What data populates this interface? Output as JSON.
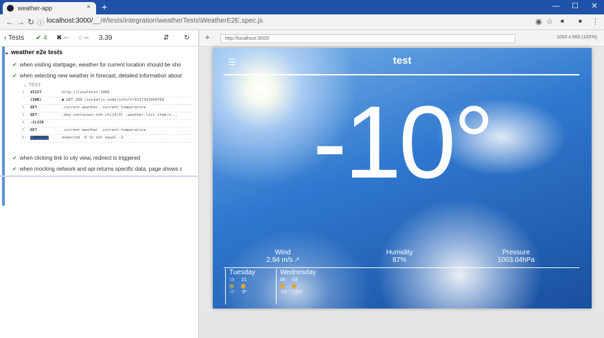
{
  "browser": {
    "tab_title": "weather-app",
    "tab_close": "×",
    "new_tab": "+",
    "url_host": "localhost:3000/",
    "url_path": "__/#/tests/integration\\weatherTests\\WeatherE2E.spec.js",
    "win_min": "—",
    "win_max": "☐",
    "win_close": "✕"
  },
  "runner": {
    "back_label": "Tests",
    "passed": "4",
    "failed": "--",
    "pending": "--",
    "duration": "3.39",
    "suite": "weather e2e tests",
    "tests": [
      "when visiting startpage, weather for current location should be sho",
      "when selecting new weather in forecast, detailed information about",
      "when clicking link to city view, redirect is triggered",
      "when mocking network and api returns specific data, page shows c"
    ],
    "test_label": "TEST",
    "commands": [
      {
        "n": "1",
        "name": "VISIT",
        "msg": "http://localhost:3000"
      },
      {
        "n": "",
        "name": "(XHR)",
        "msg": "● GET 200 /socketjs-node/info?t=1517343349760"
      },
      {
        "n": "2",
        "name": "GET",
        "msg": ".current-weather .current-temperature"
      },
      {
        "n": "3",
        "name": "GET",
        "msg": ".day-container:nth-child(4) .weather-list-item:n..."
      },
      {
        "n": "4",
        "name": "-CLICK",
        "msg": ""
      },
      {
        "n": "5",
        "name": "GET",
        "msg": ".current-weather .current-temperature"
      },
      {
        "n": "6",
        "name": "-ASSERT",
        "msg": "expected -0 to not equal -2"
      }
    ]
  },
  "viewport": {
    "url": "http://localhost:3000/",
    "size": "1000 x 660 (100%)"
  },
  "app": {
    "title": "test",
    "temperature": "-10°",
    "wind_label": "Wind",
    "wind_value": "2.94 m/s",
    "humidity_label": "Humidity",
    "humidity_value": "87%",
    "pressure_label": "Pressure",
    "pressure_value": "1003.04hPa",
    "forecast": [
      {
        "day": "Tuesday",
        "hours": [
          "18",
          "21"
        ],
        "temps": [
          "-9°",
          "9°"
        ]
      },
      {
        "day": "Wednesday",
        "hours": [
          "00",
          "03"
        ],
        "temps": [
          "-21°",
          "20°"
        ]
      }
    ]
  }
}
